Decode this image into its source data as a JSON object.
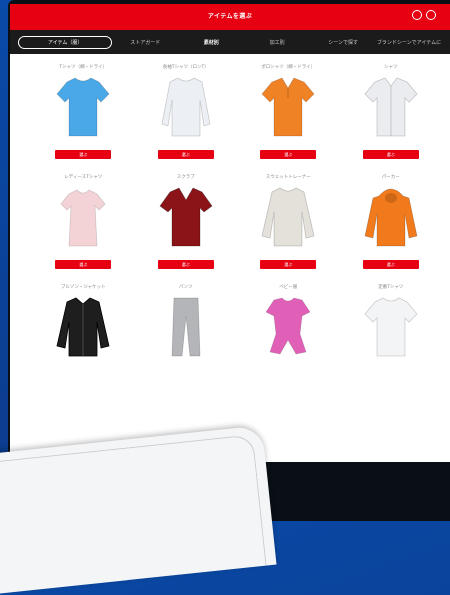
{
  "header": {
    "title": "アイテムを選ぶ"
  },
  "nav": {
    "items": [
      {
        "label": "アイテム（服）"
      },
      {
        "label": "ストアガード"
      },
      {
        "label": "素材別"
      },
      {
        "label": "加工別"
      },
      {
        "label": "シーンで探す"
      },
      {
        "label": "ブランドシーンでアイテムに"
      }
    ]
  },
  "products": [
    {
      "name": "Tシャツ（綿・ドライ）",
      "color": "#4aa8e8",
      "type": "tshirt",
      "button": "選ぶ"
    },
    {
      "name": "長袖Tシャツ（ロンT）",
      "color": "#eceff3",
      "type": "longsleeve",
      "button": "選ぶ"
    },
    {
      "name": "ポロシャツ（綿・ドライ）",
      "color": "#f08226",
      "type": "polo",
      "button": "選ぶ"
    },
    {
      "name": "シャツ",
      "color": "#eaecef",
      "type": "shirt",
      "button": "選ぶ"
    },
    {
      "name": "レディースTシャツ",
      "color": "#f3d3d6",
      "type": "ladies",
      "button": "選ぶ"
    },
    {
      "name": "スクラブ",
      "color": "#8a1418",
      "type": "scrub",
      "button": "選ぶ"
    },
    {
      "name": "スウェットトレーナー",
      "color": "#e4e1da",
      "type": "sweat",
      "button": "選ぶ"
    },
    {
      "name": "パーカー",
      "color": "#f07a1c",
      "type": "hoodie",
      "button": "選ぶ"
    },
    {
      "name": "ブルゾン・ジャケット",
      "color": "#1e1e1e",
      "type": "jacket",
      "button": ""
    },
    {
      "name": "パンツ",
      "color": "#b3b5b8",
      "type": "pants",
      "button": ""
    },
    {
      "name": "ベビー服",
      "color": "#e060b8",
      "type": "baby",
      "button": ""
    },
    {
      "name": "定番Tシャツ",
      "color": "#f3f4f6",
      "type": "tshirt",
      "button": ""
    }
  ]
}
